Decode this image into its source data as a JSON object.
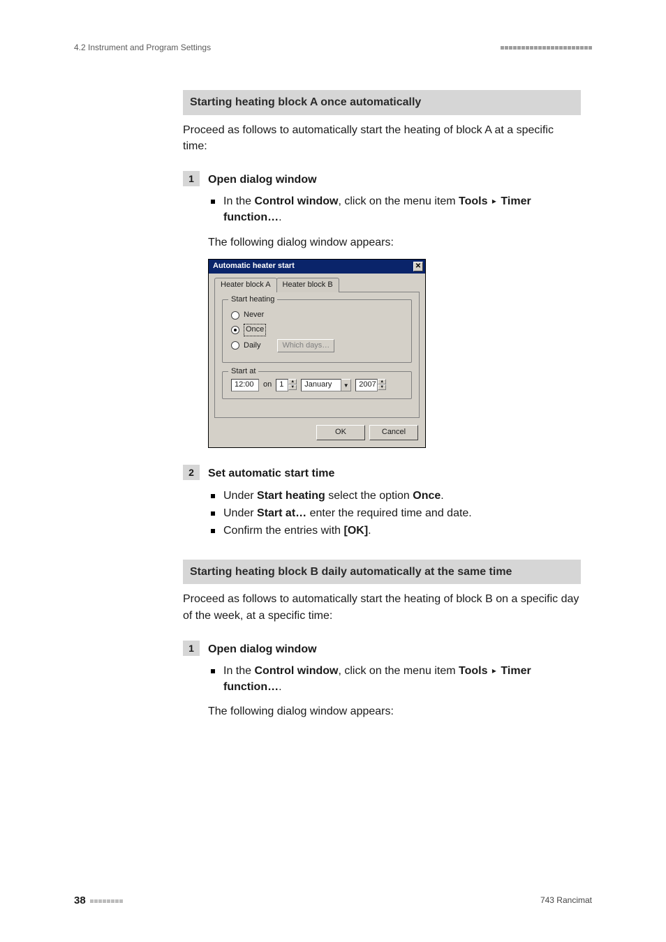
{
  "header": {
    "section": "4.2 Instrument and Program Settings"
  },
  "blockA": {
    "title": "Starting heating block A once automatically",
    "intro": "Proceed as follows to automatically start the heating of block A at a specific time:",
    "step1": {
      "num": "1",
      "title": "Open dialog window",
      "bullet_pre": "In the ",
      "bullet_bold1": "Control window",
      "bullet_mid": ", click on the menu item ",
      "bullet_bold2": "Tools",
      "bullet_sep": "▸",
      "bullet_bold3": "Timer function…",
      "bullet_end": ".",
      "after": "The following dialog window appears:"
    },
    "step2": {
      "num": "2",
      "title": "Set automatic start time",
      "b1_pre": "Under ",
      "b1_bold": "Start heating",
      "b1_mid": " select the option ",
      "b1_bold2": "Once",
      "b1_end": ".",
      "b2_pre": "Under ",
      "b2_bold": "Start at…",
      "b2_mid": " enter the required time and date.",
      "b3_pre": "Confirm the entries with ",
      "b3_bold": "[OK]",
      "b3_end": "."
    }
  },
  "blockB": {
    "title": "Starting heating block B daily automatically at the same time",
    "intro": "Proceed as follows to automatically start the heating of block B on a specific day of the week, at a specific time:",
    "step1": {
      "num": "1",
      "title": "Open dialog window",
      "bullet_pre": "In the ",
      "bullet_bold1": "Control window",
      "bullet_mid": ", click on the menu item ",
      "bullet_bold2": "Tools",
      "bullet_sep": "▸",
      "bullet_bold3": "Timer function…",
      "bullet_end": ".",
      "after": "The following dialog window appears:"
    }
  },
  "dialog": {
    "title": "Automatic heater start",
    "close": "✕",
    "tabA": "Heater block A",
    "tabB": "Heater block B",
    "grp1": "Start heating",
    "optNever": "Never",
    "optOnce": "Once",
    "optDaily": "Daily",
    "btnWhich": "Which days…",
    "grp2": "Start at",
    "time": "12:00",
    "on": "on",
    "day": "1",
    "month": "January",
    "year": "2007",
    "ok": "OK",
    "cancel": "Cancel"
  },
  "footer": {
    "page": "38",
    "doc": "743 Rancimat"
  }
}
